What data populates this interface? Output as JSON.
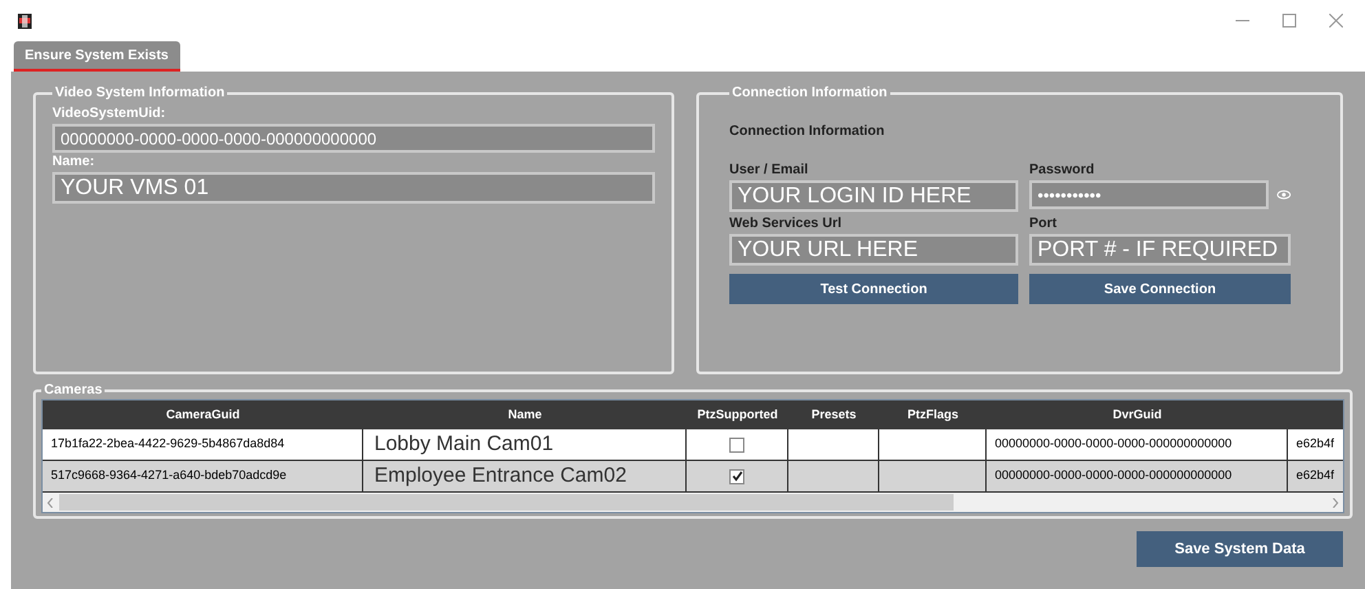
{
  "tabs": [
    {
      "label": "Ensure System Exists",
      "selected": true
    }
  ],
  "video_system": {
    "legend": "Video System Information",
    "uid_label": "VideoSystemUid:",
    "uid_value": "00000000-0000-0000-0000-000000000000",
    "name_label": "Name:",
    "name_value": "YOUR VMS 01"
  },
  "connection": {
    "legend": "Connection Information",
    "heading": "Connection Information",
    "user_label": "User / Email",
    "user_value": "YOUR LOGIN ID HERE",
    "password_label": "Password",
    "password_value": "•••••••••••",
    "url_label": "Web Services Url",
    "url_value": "YOUR URL HERE",
    "port_label": "Port",
    "port_value": "PORT # - IF REQUIRED",
    "buttons": [
      "Test Connection",
      "Save Connection"
    ]
  },
  "cameras": {
    "legend": "Cameras",
    "columns": [
      "CameraGuid",
      "Name",
      "PtzSupported",
      "Presets",
      "PtzFlags",
      "DvrGuid"
    ],
    "rows": [
      {
        "camera_guid": "17b1fa22-2bea-4422-9629-5b4867da8d84",
        "name": "Lobby Main Cam01",
        "ptz_supported": false,
        "dvr_guid": "00000000-0000-0000-0000-000000000000",
        "column_7": "e62b4f"
      },
      {
        "camera_guid": "517c9668-9364-4271-a640-bdeb70adcd9e",
        "name": "Employee Entrance Cam02",
        "ptz_supported": true,
        "dvr_guid": "00000000-0000-0000-0000-000000000000",
        "column_7": "e62b4f"
      }
    ]
  },
  "save_button": "Save System Data"
}
